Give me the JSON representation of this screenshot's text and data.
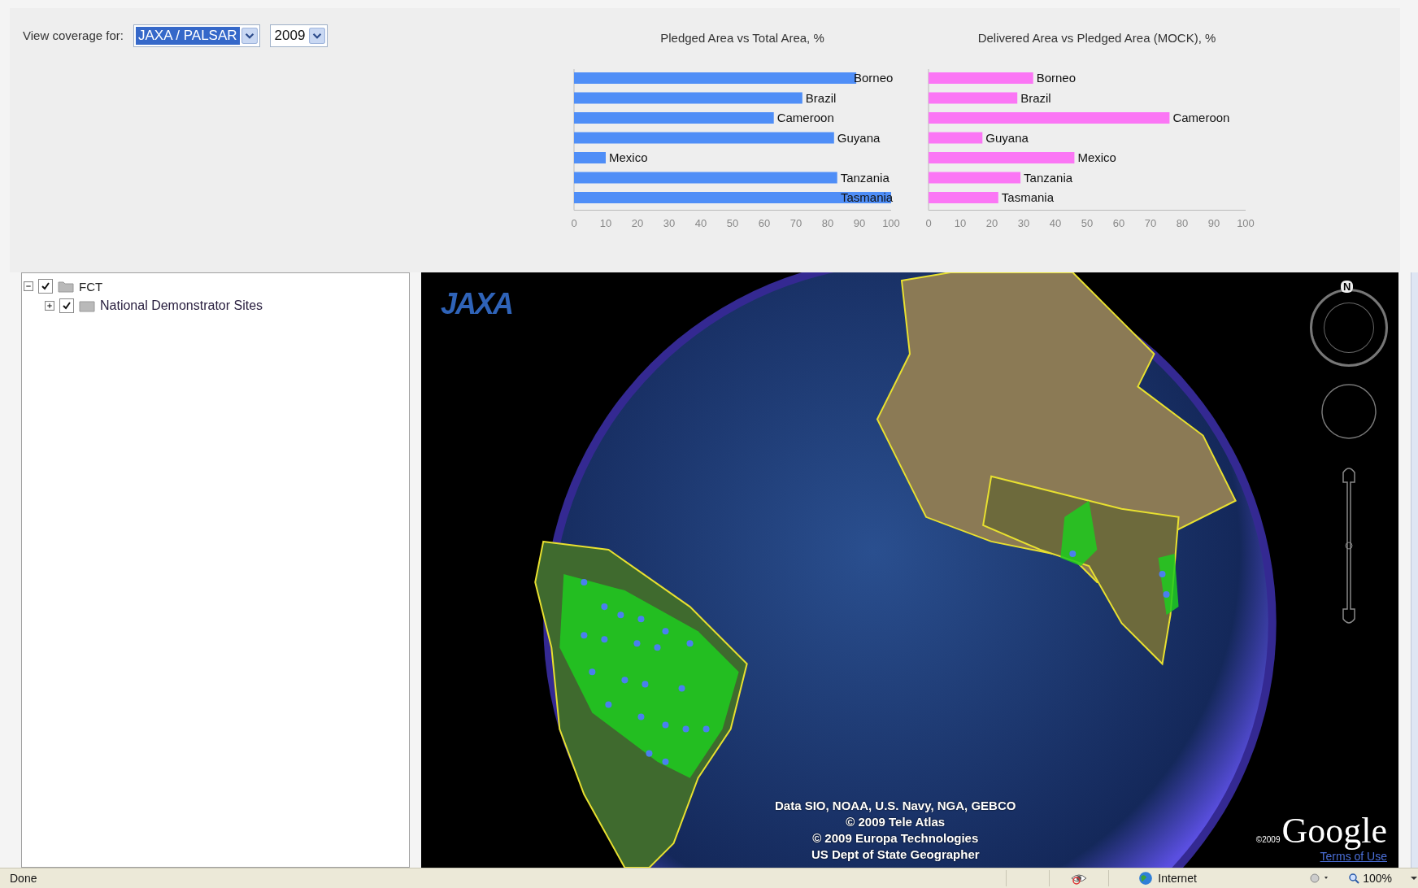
{
  "toolbar": {
    "label": "View coverage for:",
    "dropdowns": [
      {
        "value": "JAXA / PALSAR",
        "focused": true
      },
      {
        "value": "2009",
        "focused": false
      }
    ]
  },
  "charts": [
    {
      "chart_data": {
        "type": "bar",
        "orientation": "horizontal",
        "title": "Pledged Area vs Total Area, %",
        "categories": [
          "Borneo",
          "Brazil",
          "Cameroon",
          "Guyana",
          "Mexico",
          "Tanzania",
          "Tasmania"
        ],
        "series": [
          {
            "color": "#4f8ef7",
            "values": [
              89,
              72,
              63,
              82,
              10,
              83,
              100
            ]
          }
        ],
        "xlim": [
          0,
          100
        ],
        "xticks": [
          0,
          10,
          20,
          30,
          40,
          50,
          60,
          70,
          80,
          90,
          100
        ]
      }
    },
    {
      "chart_data": {
        "type": "bar",
        "orientation": "horizontal",
        "title": "Delivered Area vs Pledged Area (MOCK), %",
        "categories": [
          "Borneo",
          "Brazil",
          "Cameroon",
          "Guyana",
          "Mexico",
          "Tanzania",
          "Tasmania"
        ],
        "series": [
          {
            "color": "#fb76f5",
            "values": [
              33,
              28,
              76,
              17,
              46,
              29,
              22
            ]
          }
        ],
        "xlim": [
          0,
          100
        ],
        "xticks": [
          0,
          10,
          20,
          30,
          40,
          50,
          60,
          70,
          80,
          90,
          100
        ]
      }
    }
  ],
  "tree": {
    "items": [
      {
        "label": "FCT",
        "expanded": true,
        "checked": true,
        "children": [
          {
            "label": "National Demonstrator Sites",
            "expanded": false,
            "checked": true
          }
        ]
      }
    ]
  },
  "map": {
    "logo": "JAXA",
    "compass_label": "N",
    "attribution": [
      "Data SIO, NOAA, U.S. Navy, NGA, GEBCO",
      "© 2009 Tele Atlas",
      "© 2009 Europa Technologies",
      "US Dept of State Geographer"
    ],
    "copyright_year": "©2009",
    "brand": "Google",
    "terms_link": "Terms of Use"
  },
  "status_bar": {
    "status": "Done",
    "zone": "Internet",
    "zoom": "100%"
  }
}
